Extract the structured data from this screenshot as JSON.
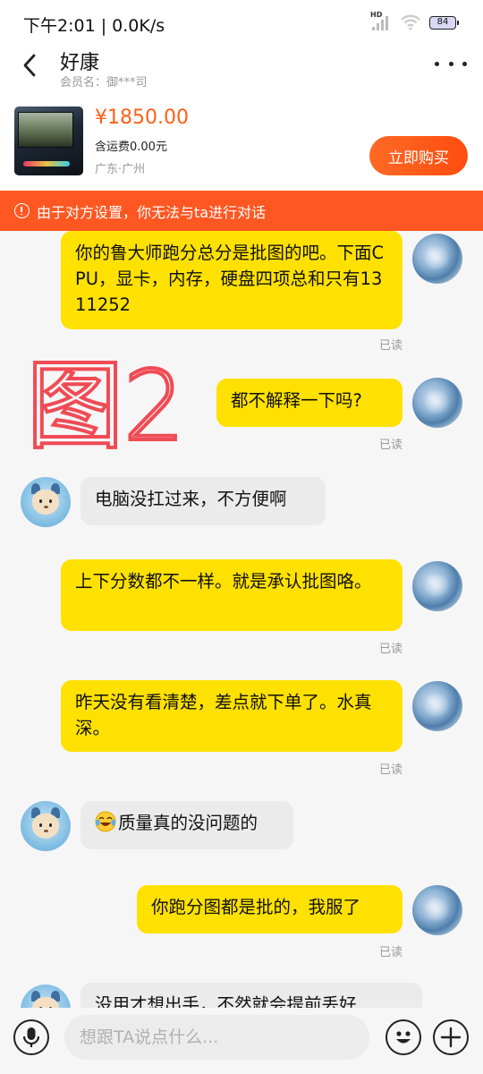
{
  "status_bar": {
    "time": "下午2:01 | 0.0K/s",
    "network_label": "HD",
    "battery": "84"
  },
  "header": {
    "title": "好康",
    "member": "会员名：御***司",
    "icons": {
      "back": "chevron-left-icon",
      "more": "more-dots-icon"
    }
  },
  "product": {
    "price": "¥1850.00",
    "shipping": "含运费0.00元",
    "location": "广东·广州",
    "buy_label": "立即购买"
  },
  "warning": {
    "text": "由于对方设置，你无法与ta进行对话",
    "icon": "info-circle-icon"
  },
  "watermark": "图2",
  "messages": [
    {
      "sender": "me",
      "text": "你的鲁大师跑分总分是批图的吧。下面CPU，显卡，内存，硬盘四项总和只有1311252",
      "status": "已读"
    },
    {
      "sender": "me",
      "text": "都不解释一下吗?",
      "status": "已读"
    },
    {
      "sender": "them",
      "text": "电脑没扛过来，不方便啊"
    },
    {
      "sender": "me",
      "text": "上下分数都不一样。就是承认批图咯。",
      "status": "已读"
    },
    {
      "sender": "me",
      "text": "昨天没有看清楚，差点就下单了。水真深。",
      "status": "已读"
    },
    {
      "sender": "them",
      "emoji": "crying-laughing-emoji",
      "text": "质量真的没问题的"
    },
    {
      "sender": "me",
      "text": "你跑分图都是批的，我服了",
      "status": "已读"
    },
    {
      "sender": "them",
      "text": "没用才想出手，不然就会提前丢好"
    }
  ],
  "input": {
    "placeholder": "想跟TA说点什么...",
    "icons": {
      "voice": "microphone-icon",
      "emoji": "smiley-icon",
      "plus": "plus-icon"
    }
  },
  "colors": {
    "accent": "#ff5722",
    "price": "#ff5f17",
    "my_bubble": "#ffe100",
    "their_bubble": "#ebebeb",
    "watermark": "#f04b55"
  }
}
